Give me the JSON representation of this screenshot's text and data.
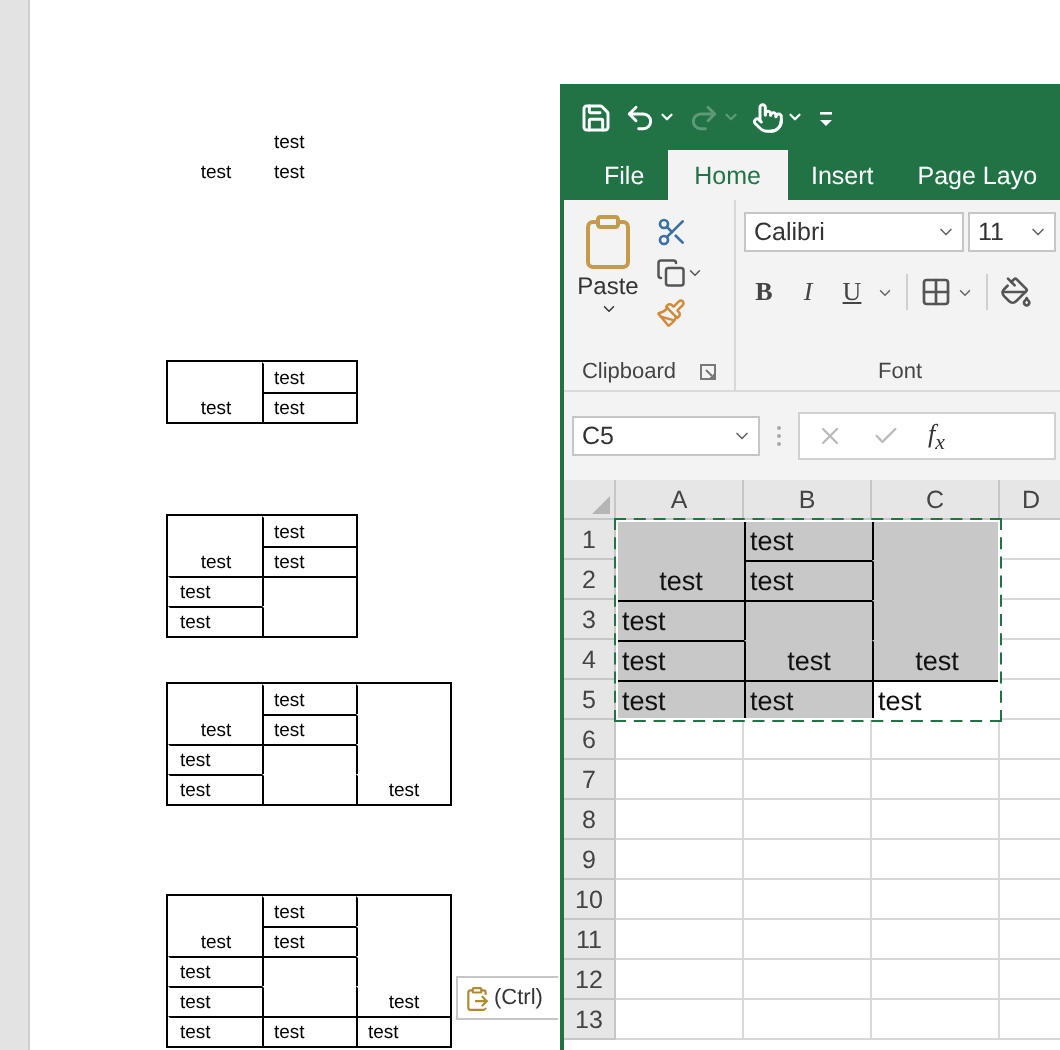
{
  "document": {
    "tables": [
      {
        "bordered": false,
        "rows": [
          [
            {
              "kind": "empty"
            },
            {
              "kind": "text",
              "text": "test"
            }
          ],
          [
            {
              "kind": "text",
              "text": "test",
              "joined_above": true
            },
            {
              "kind": "text",
              "text": "test",
              "joined_above": false
            }
          ]
        ]
      },
      {
        "bordered": true,
        "rows": [
          [
            {
              "kind": "empty"
            },
            {
              "kind": "text",
              "text": "test"
            }
          ],
          [
            {
              "kind": "text",
              "text": "test",
              "joined_above": true
            },
            {
              "kind": "text",
              "text": "test",
              "joined_above": false
            }
          ]
        ]
      },
      {
        "bordered": true,
        "rows": [
          [
            {
              "kind": "empty"
            },
            {
              "kind": "text",
              "text": "test"
            }
          ],
          [
            {
              "kind": "text",
              "text": "test",
              "joined_above": true
            },
            {
              "kind": "text",
              "text": "test",
              "joined_above": false
            }
          ],
          [
            {
              "kind": "text",
              "text": "test",
              "joined_above": false
            },
            {
              "kind": "empty",
              "joined_above": false
            }
          ],
          [
            {
              "kind": "text",
              "text": "test",
              "joined_above": false
            },
            {
              "kind": "empty",
              "joined_above": true
            }
          ]
        ]
      },
      {
        "bordered": true,
        "rows": [
          [
            {
              "kind": "empty"
            },
            {
              "kind": "text",
              "text": "test"
            },
            {
              "kind": "empty"
            }
          ],
          [
            {
              "kind": "text",
              "text": "test",
              "joined_above": true
            },
            {
              "kind": "text",
              "text": "test",
              "joined_above": false
            },
            {
              "kind": "empty",
              "joined_above": true
            }
          ],
          [
            {
              "kind": "text",
              "text": "test",
              "joined_above": false
            },
            {
              "kind": "empty",
              "joined_above": false
            },
            {
              "kind": "empty",
              "joined_above": true
            }
          ],
          [
            {
              "kind": "text",
              "text": "test",
              "joined_above": false
            },
            {
              "kind": "empty",
              "joined_above": true
            },
            {
              "kind": "text",
              "text": "test",
              "joined_above": true
            }
          ]
        ]
      },
      {
        "bordered": true,
        "rows": [
          [
            {
              "kind": "empty"
            },
            {
              "kind": "text",
              "text": "test"
            },
            {
              "kind": "empty"
            }
          ],
          [
            {
              "kind": "text",
              "text": "test",
              "joined_above": true
            },
            {
              "kind": "text",
              "text": "test",
              "joined_above": false
            },
            {
              "kind": "empty",
              "joined_above": true
            }
          ],
          [
            {
              "kind": "text",
              "text": "test",
              "joined_above": false
            },
            {
              "kind": "empty",
              "joined_above": false
            },
            {
              "kind": "empty",
              "joined_above": true
            }
          ],
          [
            {
              "kind": "text",
              "text": "test",
              "joined_above": false
            },
            {
              "kind": "empty",
              "joined_above": true
            },
            {
              "kind": "text",
              "text": "test",
              "joined_above": true
            }
          ],
          [
            {
              "kind": "text",
              "text": "test",
              "joined_above": false
            },
            {
              "kind": "text",
              "text": "test",
              "joined_above": false
            },
            {
              "kind": "text",
              "text": "test",
              "joined_above": false
            }
          ]
        ]
      }
    ],
    "paste_options": {
      "label": "(Ctrl)"
    }
  },
  "excel": {
    "quick_access": [
      {
        "kind": "save",
        "disabled": false
      },
      {
        "kind": "undo",
        "disabled": false
      },
      {
        "kind": "redo",
        "disabled": true
      },
      {
        "kind": "touch",
        "disabled": false
      },
      {
        "kind": "customize",
        "disabled": false
      }
    ],
    "tabs": [
      {
        "label": "File",
        "selected": false
      },
      {
        "label": "Home",
        "selected": true
      },
      {
        "label": "Insert",
        "selected": false
      },
      {
        "label": "Page Layo",
        "selected": false
      }
    ],
    "clipboard": {
      "paste_label": "Paste",
      "group_label": "Clipboard"
    },
    "font": {
      "font_name": "Calibri",
      "font_size": "11",
      "styles": [
        {
          "kind": "bold",
          "label": "B"
        },
        {
          "kind": "italic",
          "label": "I"
        },
        {
          "kind": "underline",
          "label": "U"
        }
      ],
      "group_label": "Font"
    },
    "formula_bar": {
      "name_box": "C5",
      "function_label": "f$_{x}$"
    },
    "grid": {
      "columns": [
        "A",
        "B",
        "C",
        "D"
      ],
      "row_headers": [
        "1",
        "2",
        "3",
        "4",
        "5",
        "6",
        "7",
        "8",
        "9",
        "10",
        "11",
        "12",
        "13"
      ],
      "rows": [
        [
          {
            "kind": "empty",
            "shaded": true
          },
          {
            "kind": "text",
            "text": "test",
            "shaded": true
          },
          {
            "kind": "empty",
            "shaded": true
          }
        ],
        [
          {
            "kind": "text",
            "text": "test",
            "joined_above": true,
            "shaded": true
          },
          {
            "kind": "text",
            "text": "test",
            "joined_above": false,
            "shaded": true
          },
          {
            "kind": "empty",
            "joined_above": true,
            "shaded": true
          }
        ],
        [
          {
            "kind": "text",
            "text": "test",
            "joined_above": false,
            "shaded": true
          },
          {
            "kind": "empty",
            "joined_above": false,
            "shaded": true
          },
          {
            "kind": "empty",
            "joined_above": true,
            "shaded": true
          }
        ],
        [
          {
            "kind": "text",
            "text": "test",
            "joined_above": false,
            "shaded": true
          },
          {
            "kind": "text",
            "text": "test",
            "joined_above": true,
            "shaded": true
          },
          {
            "kind": "text",
            "text": "test",
            "joined_above": true,
            "shaded": true
          }
        ],
        [
          {
            "kind": "text",
            "text": "test",
            "joined_above": false,
            "shaded": true
          },
          {
            "kind": "text",
            "text": "test",
            "joined_above": false,
            "shaded": true
          },
          {
            "kind": "text",
            "text": "test",
            "joined_above": false,
            "shaded": false
          }
        ]
      ]
    }
  }
}
